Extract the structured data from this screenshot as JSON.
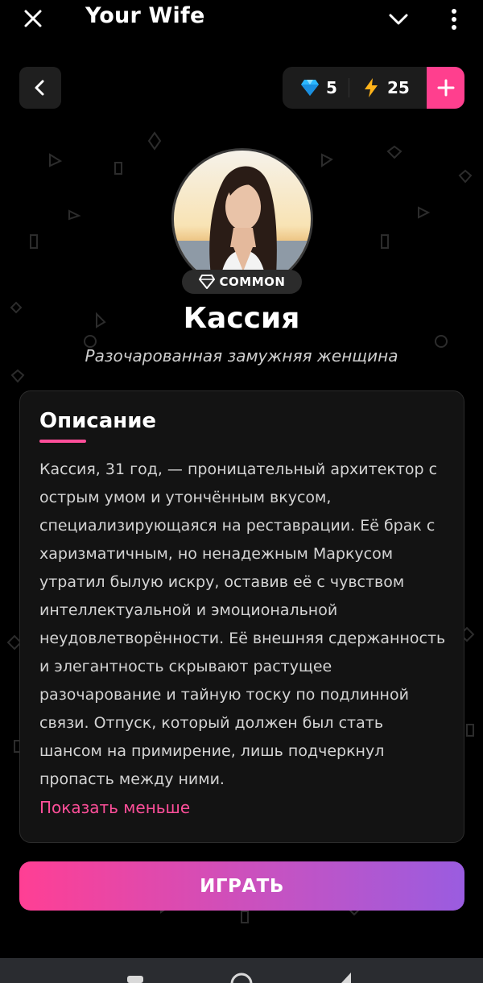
{
  "app": {
    "title": "Your Wife"
  },
  "currency": {
    "gems": "5",
    "energy": "25"
  },
  "character": {
    "rarity": "COMMON",
    "name": "Кассия",
    "subtitle": "Разочарованная замужняя женщина"
  },
  "description": {
    "title": "Описание",
    "text": "Кассия, 31 год, — проницательный архитектор с острым умом и утончённым вкусом, специализирующаяся на реставрации. Её брак с харизматичным, но ненадежным Маркусом утратил былую искру, оставив её с чувством интеллектуальной и эмоциональной неудовлетворённости. Её внешняя сдержанность и элегантность скрывают растущее разочарование и тайную тоску по подлинной связи. Отпуск, который должен был стать шансом на примирение, лишь подчеркнул пропасть между ними.",
    "toggle_label": "Показать меньше"
  },
  "actions": {
    "play_label": "ИГРАТЬ"
  },
  "colors": {
    "accent": "#ff3f8e",
    "gradient_end": "#9a5ce0",
    "background": "#000000"
  },
  "icons": {
    "close": "close-icon",
    "collapse": "chevron-down-icon",
    "menu": "more-vertical-icon",
    "back": "chevron-left-icon",
    "gem": "diamond-icon",
    "energy": "lightning-icon",
    "add": "plus-icon"
  }
}
